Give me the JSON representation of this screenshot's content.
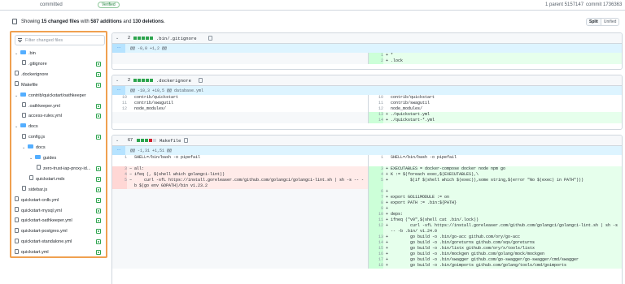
{
  "commit_bar": {
    "committed_label": "committed",
    "verified_label": "Verified",
    "parent_text": "1 parent 5157147",
    "commit_text": "commit 1736363"
  },
  "stats": {
    "prefix": "Showing ",
    "changed": "15 changed files",
    "mid1": " with ",
    "additions": "587 additions",
    "mid2": " and ",
    "deletions": "130 deletions",
    "suffix": ".",
    "split_label": "Split",
    "unified_label": "Unified"
  },
  "file_tree": {
    "filter_placeholder": "Filter changed files",
    "accent_color": "#f0a050",
    "nodes": [
      {
        "label": ".bin",
        "type": "folder",
        "depth": 0
      },
      {
        "label": ".gitignore",
        "type": "file",
        "depth": 1
      },
      {
        "label": ".dockerignore",
        "type": "file",
        "depth": 0
      },
      {
        "label": "Makefile",
        "type": "file",
        "depth": 0
      },
      {
        "label": "contrib/quickstart/oathkeeper",
        "type": "folder",
        "depth": 0
      },
      {
        "label": ".oathkeeper.yml",
        "type": "file",
        "depth": 1
      },
      {
        "label": "access-rules.yml",
        "type": "file",
        "depth": 1
      },
      {
        "label": "docs",
        "type": "folder",
        "depth": 0
      },
      {
        "label": "config.js",
        "type": "file",
        "depth": 1
      },
      {
        "label": "docs",
        "type": "folder",
        "depth": 1
      },
      {
        "label": "guides",
        "type": "folder",
        "depth": 2
      },
      {
        "label": "zero-trust-iap-proxy-id...",
        "type": "file",
        "depth": 3
      },
      {
        "label": "quickstart.mdx",
        "type": "file",
        "depth": 2
      },
      {
        "label": "sidebar.js",
        "type": "file",
        "depth": 1
      },
      {
        "label": "quickstart-crdb.yml",
        "type": "file",
        "depth": 0
      },
      {
        "label": "quickstart-mysql.yml",
        "type": "file",
        "depth": 0
      },
      {
        "label": "quickstart-oathkeeper.yml",
        "type": "file",
        "depth": 0
      },
      {
        "label": "quickstart-postgres.yml",
        "type": "file",
        "depth": 0
      },
      {
        "label": "quickstart-standalone.yml",
        "type": "file",
        "depth": 0
      },
      {
        "label": "quickstart.yml",
        "type": "file",
        "depth": 0
      }
    ]
  },
  "diffs": {
    "gitignore": {
      "count": "2",
      "name": ".bin/.gitignore",
      "hunk": "@@ -0,0 +1,2 @@",
      "rows": [
        {
          "rn": "1",
          "code": "*"
        },
        {
          "rn": "2",
          "code": ".lock"
        }
      ]
    },
    "dockerignore": {
      "count": "2",
      "name": ".dockerignore",
      "hunk": "@@ -10,3 +10,5 @@ database.yml",
      "rows": [
        {
          "ln": "10",
          "lcode": "contrib/quickstart",
          "rn": "10",
          "rcode": "contrib/quickstart"
        },
        {
          "ln": "11",
          "lcode": "contrib/swagutil",
          "rn": "11",
          "rcode": "contrib/swagutil"
        },
        {
          "ln": "12",
          "lcode": "node_modules/",
          "rn": "12",
          "rcode": "node_modules/"
        },
        {
          "rn": "13",
          "rcode": "./quickstart.yml"
        },
        {
          "rn": "14",
          "rcode": "./quickstart-*.yml"
        }
      ]
    },
    "makefile": {
      "count": "67",
      "name": "Makefile",
      "hunk": "@@ -1,31 +1,51 @@",
      "context": {
        "ln": "1",
        "lcode": "SHELL=/bin/bash -o pipefail",
        "rn": "1",
        "rcode": "SHELL=/bin/bash -o pipefail"
      },
      "left_del": [
        {
          "n": "3",
          "code": "all:"
        },
        {
          "n": "4",
          "code": "ifeq (, $(shell which golangci-lint))"
        },
        {
          "n": "5",
          "code": "    curl -sfL https://install.goreleaser.com/github.com/golangci/golangci-lint.sh | sh -s -- -b $(go env GOPATH)/bin v1.23.2"
        }
      ],
      "right_add": [
        {
          "n": "3",
          "code": "EXECUTABLES = docker-compose docker node npm go"
        },
        {
          "n": "4",
          "code": "K := $(foreach exec,$(EXECUTABLES),\\"
        },
        {
          "n": "5",
          "code": "        $(if $(shell which $(exec)),some string,$(error \"No $(exec) in PATH\")))"
        },
        {
          "n": "6",
          "code": ""
        },
        {
          "n": "7",
          "code": "export GO111MODULE := on"
        },
        {
          "n": "8",
          "code": "export PATH := .bin:${PATH}"
        },
        {
          "n": "9",
          "code": ""
        },
        {
          "n": "10",
          "code": "deps:"
        },
        {
          "n": "11",
          "code": "ifneq (\"v0\",$(shell cat .bin/.lock))"
        },
        {
          "n": "12",
          "code": "        curl -sfL https://install.goreleaser.com/github.com/golangci/golangci-lint.sh | sh -s -- -b .bin/ v1.24.0"
        },
        {
          "n": "13",
          "code": "        go build -o .bin/go-acc github.com/ory/go-acc"
        },
        {
          "n": "14",
          "code": "        go build -o .bin/goreturns github.com/sqs/goreturns"
        },
        {
          "n": "15",
          "code": "        go build -o .bin/listx github.com/ory/x/tools/listx"
        },
        {
          "n": "16",
          "code": "        go build -o .bin/mockgen github.com/golang/mock/mockgen"
        },
        {
          "n": "17",
          "code": "        go build -o .bin/swagger github.com/go-swagger/go-swagger/cmd/swagger"
        },
        {
          "n": "18",
          "code": "        go build -o .bin/goimports github.com/golang/tools/cmd/goimports"
        }
      ]
    }
  },
  "colors": {
    "add_bg": "#e6ffec",
    "del_bg": "#ffebe9",
    "hunk_bg": "#ddf4ff",
    "folder": "#54aeff"
  }
}
